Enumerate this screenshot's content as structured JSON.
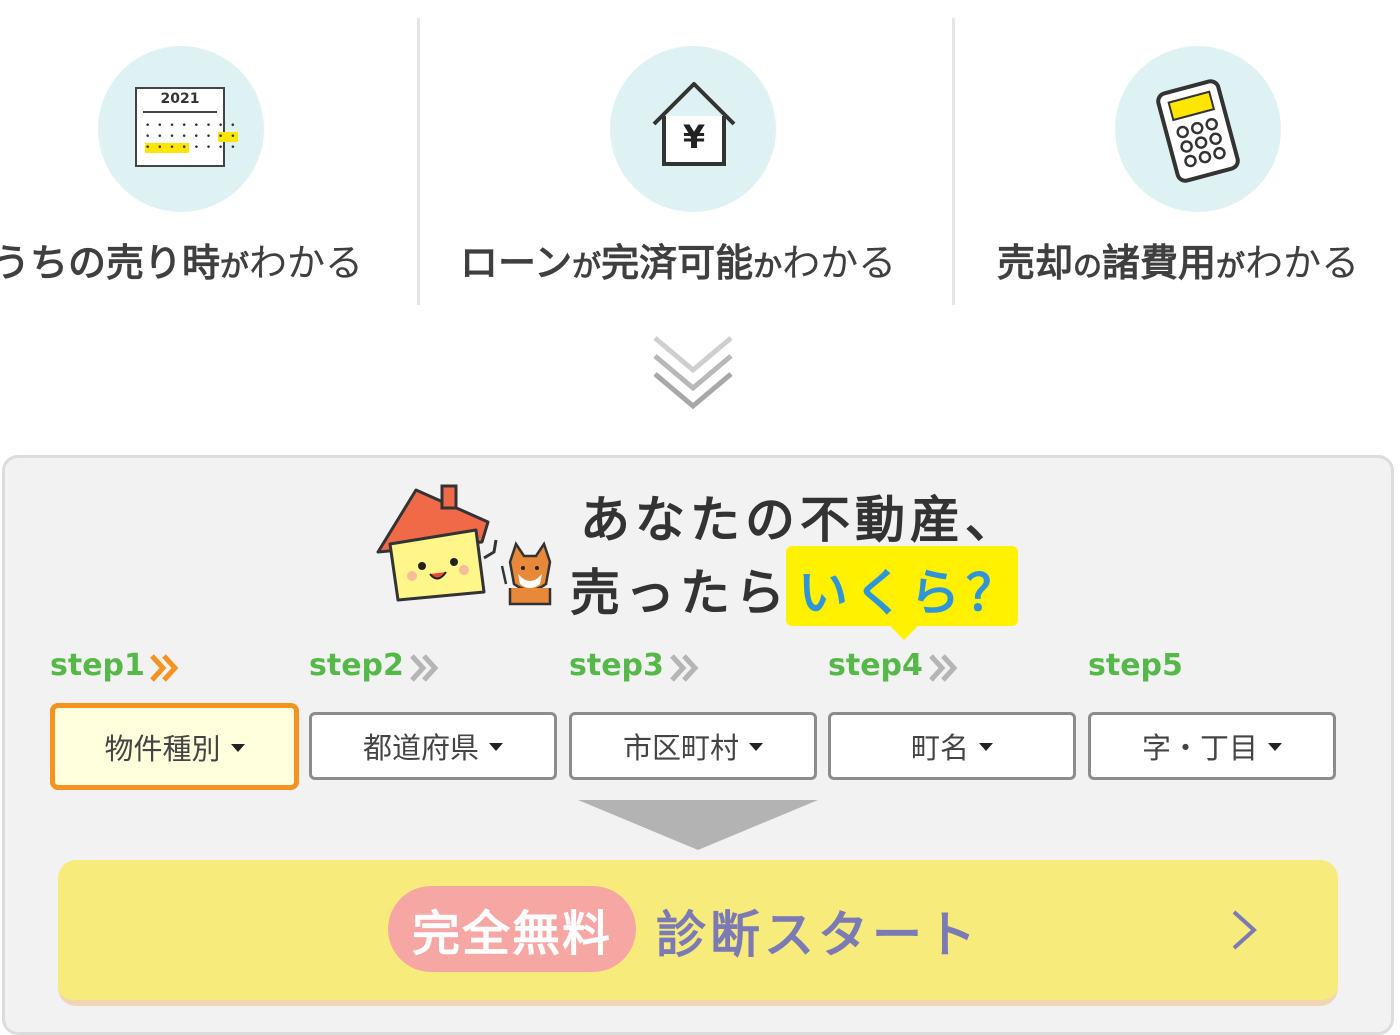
{
  "features": [
    {
      "bold_a": "うちの売り時",
      "small": "が",
      "light": "わかる",
      "icon": "calendar-icon",
      "calendar_year": "2021"
    },
    {
      "bold_a": "ローン",
      "small": "が",
      "bold_b": "完済可能",
      "small2": "か",
      "light": "わかる",
      "icon": "house-yen-icon",
      "yen_symbol": "¥"
    },
    {
      "bold_a": "売却",
      "small": "の",
      "bold_b": "諸費用",
      "small2": "が",
      "light": "わかる",
      "icon": "calculator-icon"
    }
  ],
  "headline": {
    "line1": "あなたの不動産、",
    "line2": "売ったら",
    "highlight": "いくら？"
  },
  "steps": [
    {
      "label": "step1",
      "value": "物件種別",
      "active": true
    },
    {
      "label": "step2",
      "value": "都道府県",
      "active": false
    },
    {
      "label": "step3",
      "value": "市区町村",
      "active": false
    },
    {
      "label": "step4",
      "value": "町名",
      "active": false
    },
    {
      "label": "step5",
      "value": "字・丁目",
      "active": false
    }
  ],
  "cta": {
    "badge": "完全無料",
    "label": "診断スタート"
  },
  "colors": {
    "step_green": "#56b848",
    "active_orange": "#f4931f",
    "highlight_yellow": "#fff100",
    "ikura_blue": "#2e95d8",
    "cta_yellow": "#f7eb7c",
    "cta_pink": "#f6a7a3",
    "cta_purple": "#7b7ab4"
  }
}
